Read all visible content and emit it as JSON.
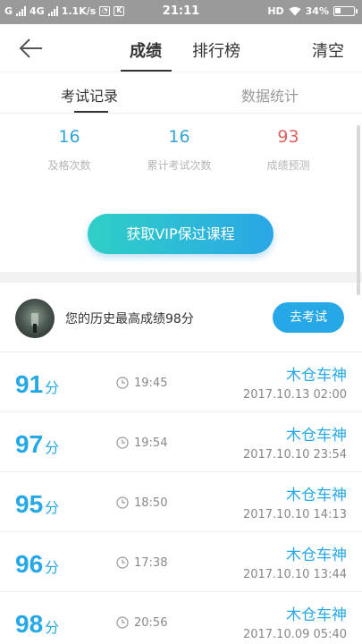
{
  "status_bar": {
    "carrier1": "G",
    "carrier2": "4G",
    "speed": "1.1K/s",
    "time": "21:11",
    "hd": "HD",
    "battery": "34%",
    "battery_level": 0.34
  },
  "header": {
    "tabs": [
      {
        "label": "成绩"
      },
      {
        "label": "排行榜"
      }
    ],
    "clear_label": "清空"
  },
  "sub_tabs": [
    {
      "label": "考试记录"
    },
    {
      "label": "数据统计"
    }
  ],
  "stats": [
    {
      "value": "16",
      "label": "及格次数"
    },
    {
      "value": "16",
      "label": "累计考试次数"
    },
    {
      "value": "93",
      "label": "成绩预测"
    }
  ],
  "vip_button": "获取VIP保过课程",
  "best": {
    "text": "您的历史最高成绩98分",
    "button": "去考试"
  },
  "records": [
    {
      "score": "91",
      "unit": "分",
      "duration": "19:45",
      "user": "木仓车神",
      "date": "2017.10.13  02:00"
    },
    {
      "score": "97",
      "unit": "分",
      "duration": "19:54",
      "user": "木仓车神",
      "date": "2017.10.10  23:54"
    },
    {
      "score": "95",
      "unit": "分",
      "duration": "18:50",
      "user": "木仓车神",
      "date": "2017.10.10  14:13"
    },
    {
      "score": "96",
      "unit": "分",
      "duration": "17:38",
      "user": "木仓车神",
      "date": "2017.10.10  13:44"
    },
    {
      "score": "98",
      "unit": "分",
      "duration": "20:56",
      "user": "木仓车神",
      "date": "2017.10.09  05:40"
    }
  ],
  "colors": {
    "accent": "#27a8e6",
    "prediction": "#e06060"
  }
}
